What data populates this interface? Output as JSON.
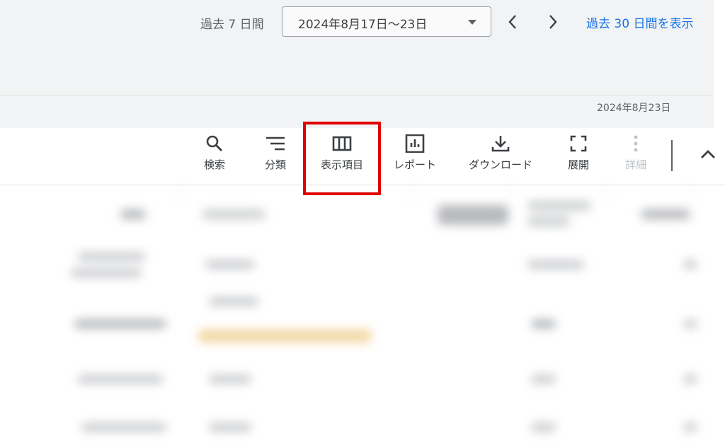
{
  "header": {
    "range_label": "過去 7 日間",
    "date_range": "2024年8月17日～23日",
    "show_30_days_link": "過去 30 日間を表示"
  },
  "subheader": {
    "date": "2024年8月23日"
  },
  "toolbar": {
    "search": "検索",
    "segment": "分類",
    "columns": "表示項目",
    "report": "レポート",
    "download": "ダウンロード",
    "expand": "展開",
    "more": "詳細"
  },
  "colors": {
    "link": "#1a73e8",
    "highlight": "#e00000",
    "header_bg": "#f1f3f4"
  },
  "icons": [
    "calendar-dropdown-icon",
    "chevron-left-icon",
    "chevron-right-icon",
    "search-icon",
    "filter-lines-icon",
    "columns-icon",
    "report-chart-icon",
    "download-icon",
    "fullscreen-icon",
    "more-vert-icon",
    "chevron-up-icon"
  ]
}
